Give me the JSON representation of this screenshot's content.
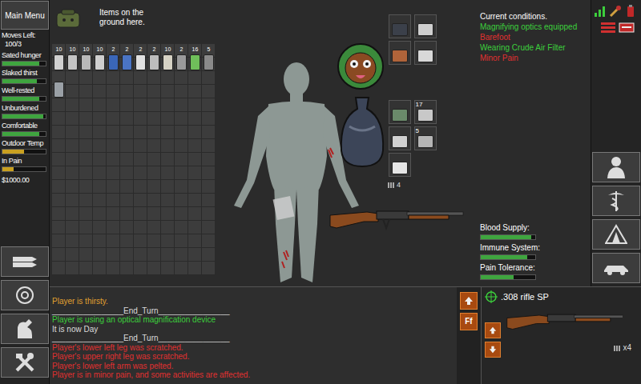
{
  "header": {
    "menu": "Main Menu",
    "ground_label": "Items on the ground here."
  },
  "moves": {
    "label": "Moves Left:",
    "value": "100/3"
  },
  "stats": [
    {
      "label": "Sated hunger",
      "level": 0.85
    },
    {
      "label": "Slaked thirst",
      "level": 0.8
    },
    {
      "label": "Well-rested",
      "level": 0.85
    },
    {
      "label": "Unburdened",
      "level": 0.95
    },
    {
      "label": "Comfortable",
      "level": 0.85
    },
    {
      "label": "Outdoor Temp",
      "level": 0.5
    },
    {
      "label": "In Pain",
      "level": 0.25
    }
  ],
  "money": "$1000.00",
  "ground_items": [
    {
      "count": "10",
      "color": "#d0d0d0"
    },
    {
      "count": "10",
      "color": "#c4c4c4"
    },
    {
      "count": "10",
      "color": "#b8b8b8"
    },
    {
      "count": "10",
      "color": "#cfcfcf"
    },
    {
      "count": "2",
      "color": "#3a66b8"
    },
    {
      "count": "2",
      "color": "#4a74c4"
    },
    {
      "count": "2",
      "color": "#e0e0e0"
    },
    {
      "count": "2",
      "color": "#bdbdbd"
    },
    {
      "count": "10",
      "color": "#d6d2c4"
    },
    {
      "count": "2",
      "color": "#9a9a9a"
    },
    {
      "count": "16",
      "color": "#6fbf5a"
    },
    {
      "count": "5",
      "color": "#8a8a8a"
    },
    {
      "color": "#9aa0a6"
    }
  ],
  "equipment": {
    "upper_items": [
      {
        "color": "#3b404a"
      },
      {
        "color": "#cfcfcf"
      },
      {
        "color": "#b0643a"
      },
      {
        "color": "#d8d8d8"
      }
    ],
    "pack_items": [
      {
        "color": "#6a8a6a"
      },
      {
        "count": "17",
        "color": "#c8c8c8"
      },
      {
        "color": "#d0d0d0"
      },
      {
        "count": "5",
        "color": "#b5b5b5"
      },
      {
        "color": "#e6e6e6"
      }
    ],
    "ammo": "4"
  },
  "conditions": {
    "title": "Current conditions.",
    "items": [
      {
        "text": "Magnifying optics equipped",
        "good": true
      },
      {
        "text": "Barefoot",
        "good": false
      },
      {
        "text": "Wearing Crude Air Filter",
        "good": true
      },
      {
        "text": "Minor Pain",
        "good": false
      }
    ]
  },
  "vitals": [
    {
      "label": "Blood Supply:",
      "level": 0.92
    },
    {
      "label": "Immune System:",
      "level": 0.85
    },
    {
      "label": "Pain Tolerance:",
      "level": 0.6
    }
  ],
  "log": [
    {
      "text": "Player is thirsty.",
      "color": "#e0a030"
    },
    {
      "text": "________________End_Turn________________",
      "color": "#dcdcdc"
    },
    {
      "text": "Player is using an optical magnification device",
      "color": "#3ccf3c"
    },
    {
      "text": "It is now Day",
      "color": "#dcdcdc"
    },
    {
      "text": "________________End_Turn________________",
      "color": "#dcdcdc"
    },
    {
      "text": "Player's lower left leg was scratched.",
      "color": "#e03030"
    },
    {
      "text": "Player's upper right leg was scratched.",
      "color": "#e03030"
    },
    {
      "text": "Player's lower left arm was pelted.",
      "color": "#e03030"
    },
    {
      "text": "Player is in minor pain, and some activities are affected.",
      "color": "#e03030"
    }
  ],
  "controls": {
    "fire_mode": "Ff"
  },
  "weapon": {
    "name": ".308 rifle SP",
    "ammo": "x4"
  }
}
